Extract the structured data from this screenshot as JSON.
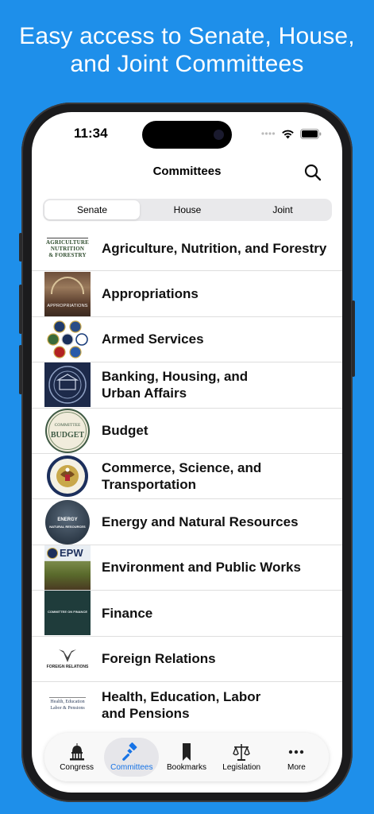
{
  "promo": {
    "line1": "Easy access to Senate, House,",
    "line2": "and Joint Committees"
  },
  "status_bar": {
    "time": "11:34"
  },
  "nav": {
    "title": "Committees"
  },
  "segments": [
    {
      "label": "Senate",
      "selected": true
    },
    {
      "label": "House",
      "selected": false
    },
    {
      "label": "Joint",
      "selected": false
    }
  ],
  "committees": [
    {
      "name": "Agriculture, Nutrition, and Forestry",
      "logo_text": [
        "AGRICULTURE",
        "NUTRITION",
        "& FORESTRY"
      ]
    },
    {
      "name": "Appropriations",
      "logo_text": [
        "APPROPRIATIONS"
      ]
    },
    {
      "name": "Armed Services"
    },
    {
      "name": "Banking, Housing, and",
      "name2": "Urban Affairs"
    },
    {
      "name": "Budget",
      "logo_text": [
        "COMMITTEE",
        "BUDGET"
      ]
    },
    {
      "name": "Commerce, Science, and",
      "name2": "Transportation"
    },
    {
      "name": "Energy and Natural Resources",
      "logo_text": [
        "ENERGY",
        "NATURAL RESOURCES"
      ]
    },
    {
      "name": "Environment and Public Works",
      "logo_text": [
        "EPW"
      ]
    },
    {
      "name": "Finance",
      "logo_text": [
        "COMMITTEE ON FINANCE"
      ]
    },
    {
      "name": "Foreign Relations",
      "logo_text": [
        "FOREIGN RELATIONS"
      ]
    },
    {
      "name": "Health, Education, Labor",
      "name2": "and Pensions",
      "logo_text": [
        "Health, Education",
        "Labor & Pensions"
      ]
    }
  ],
  "tabs": [
    {
      "label": "Congress",
      "icon": "capitol-icon",
      "selected": false
    },
    {
      "label": "Committees",
      "icon": "gavel-icon",
      "selected": true
    },
    {
      "label": "Bookmarks",
      "icon": "bookmark-icon",
      "selected": false
    },
    {
      "label": "Legislation",
      "icon": "scales-icon",
      "selected": false
    },
    {
      "label": "More",
      "icon": "ellipsis-icon",
      "selected": false
    }
  ],
  "colors": {
    "background": "#1E8FEA",
    "accent": "#1673E6"
  }
}
